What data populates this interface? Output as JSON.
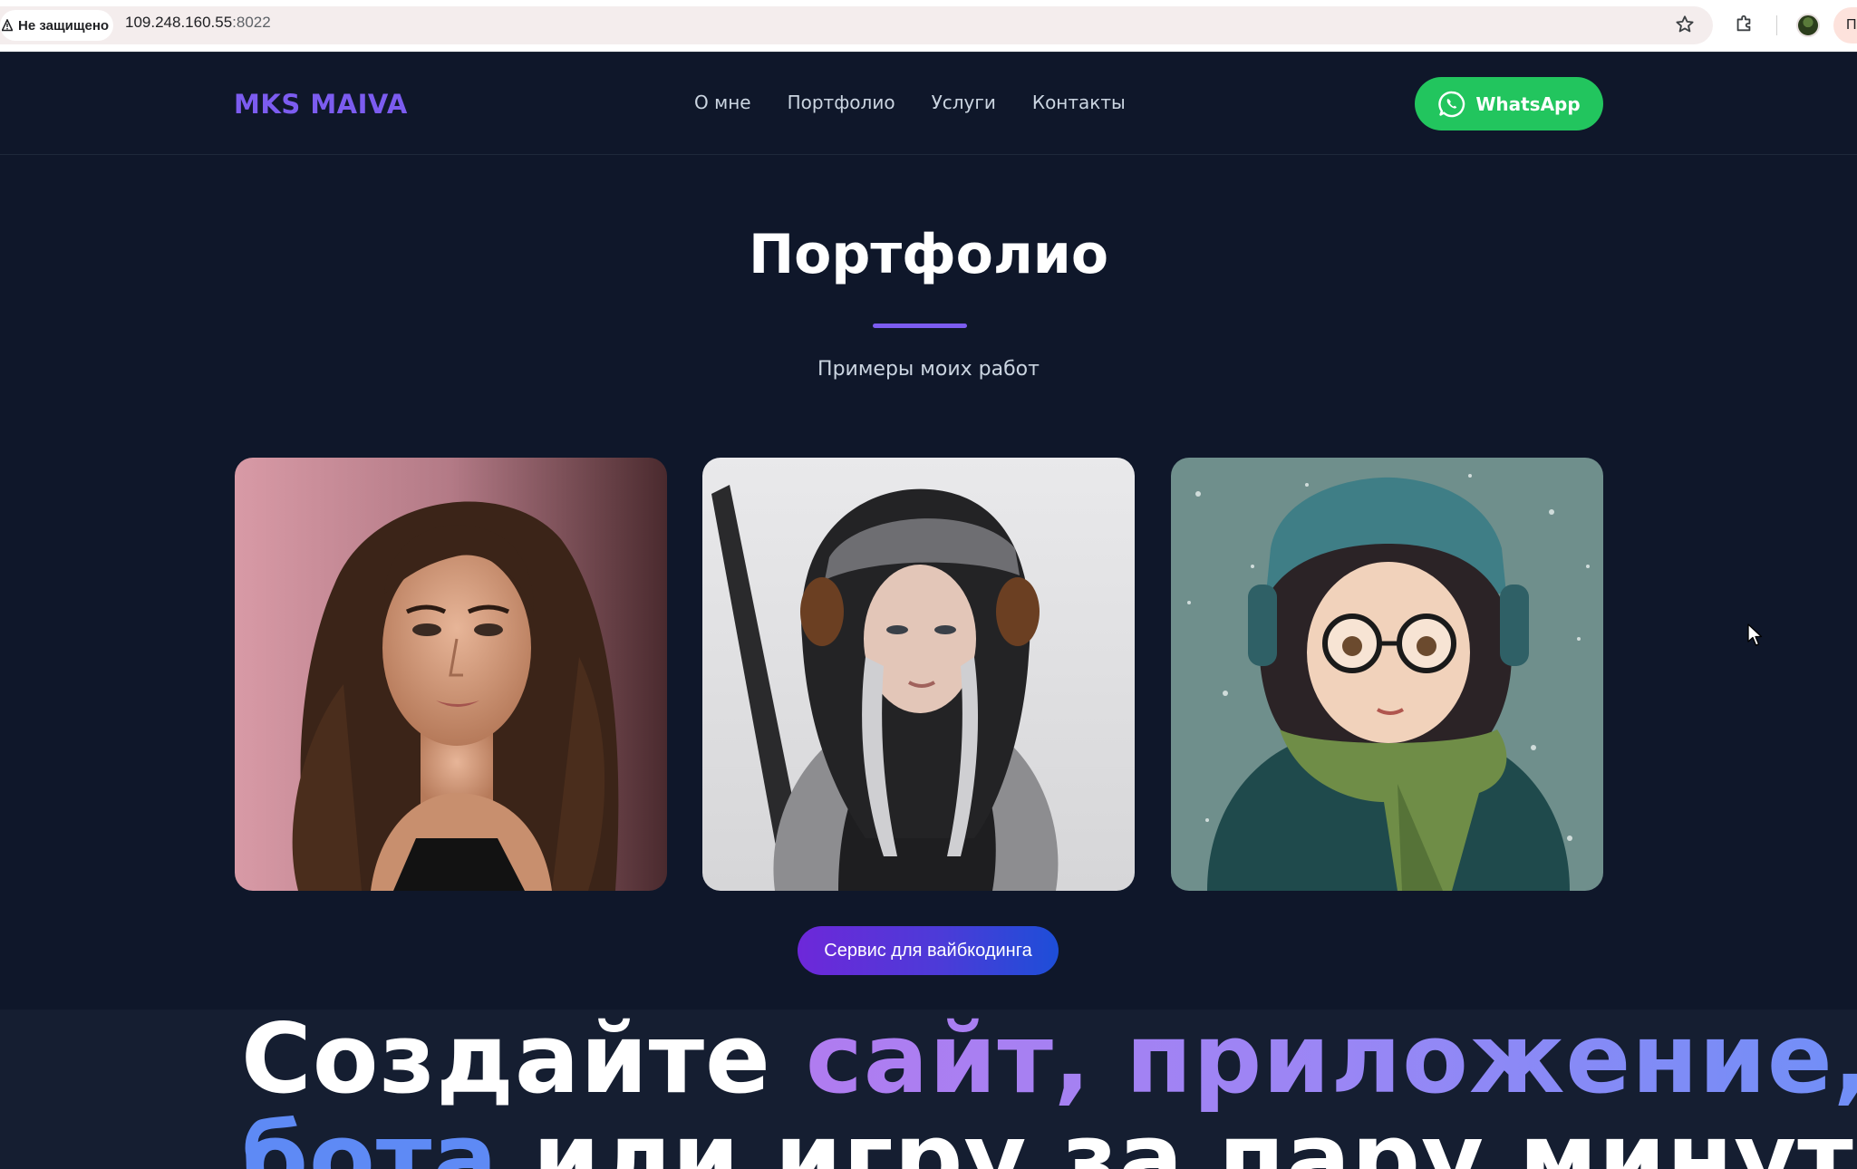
{
  "browser": {
    "security_label": "Не защищено",
    "url_host": "109.248.160.55",
    "url_port": ":8022",
    "menu_label": "П"
  },
  "header": {
    "logo": "MKS MAIVA",
    "nav": [
      "О мне",
      "Портфолио",
      "Услуги",
      "Контакты"
    ],
    "whatsapp_label": "WhatsApp"
  },
  "portfolio": {
    "title": "Портфолио",
    "subtitle": "Примеры моих работ",
    "cta_label": "Сервис для вайбкодинга"
  },
  "caption": {
    "line1_plain": "Создайте ",
    "line1_highlight": "сайт, приложение,",
    "line2_highlight": "бота",
    "line2_plain": " или игру за пару минут"
  },
  "colors": {
    "page_bg": "#0f172a",
    "accent_purple": "#7c5cf0",
    "whatsapp_green": "#22c55e"
  }
}
